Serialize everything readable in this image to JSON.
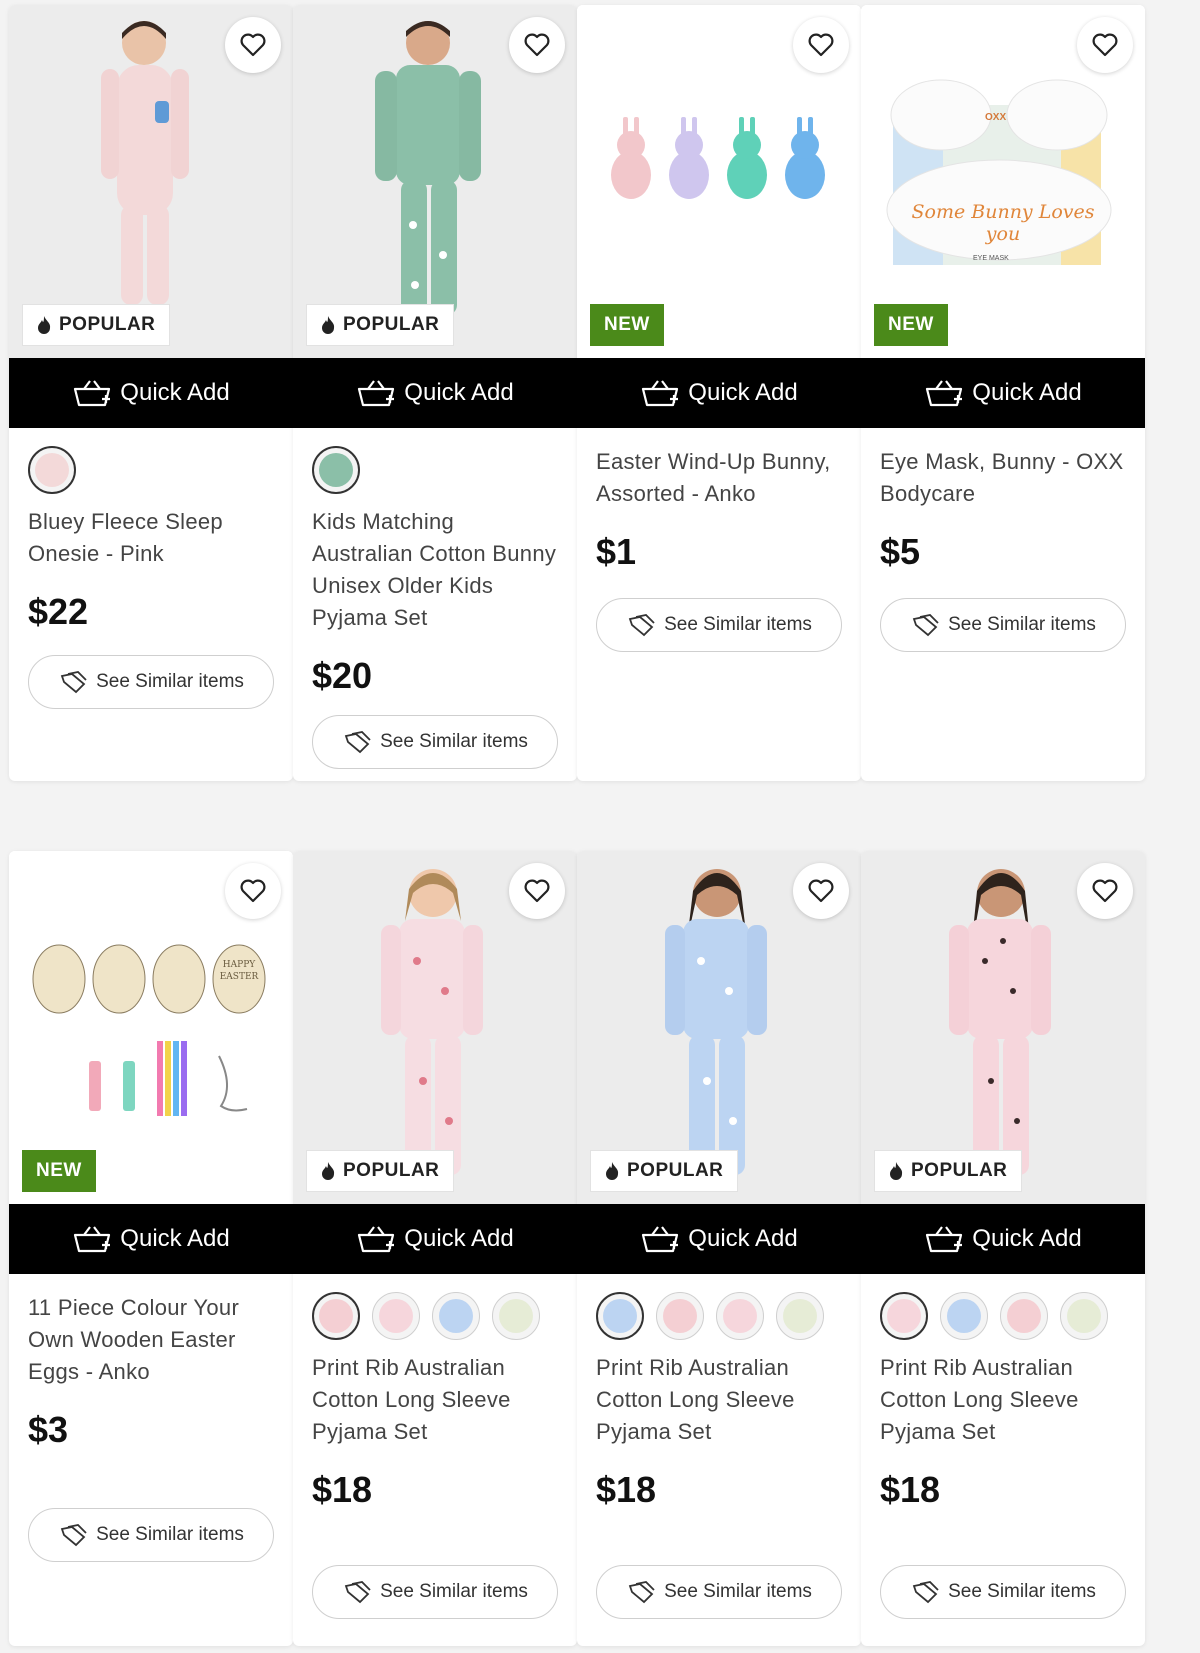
{
  "products": [
    {
      "badge": "POPULAR",
      "badge_type": "popular",
      "quick_add": "Quick Add",
      "title": "Bluey Fleece Sleep Onesie - Pink",
      "price": "$22",
      "similar": "See Similar items",
      "swatches": [
        "#f3d9d9"
      ],
      "selected_swatch": 0
    },
    {
      "badge": "POPULAR",
      "badge_type": "popular",
      "quick_add": "Quick Add",
      "title": "Kids Matching Australian Cotton Bunny Unisex Older Kids Pyjama Set",
      "price": "$20",
      "similar": "See Similar items",
      "swatches": [
        "#8bbfa8"
      ],
      "selected_swatch": 0
    },
    {
      "badge": "NEW",
      "badge_type": "new",
      "quick_add": "Quick Add",
      "title": "Easter Wind-Up Bunny, Assorted - Anko",
      "price": "$1",
      "similar": "See Similar items",
      "swatches": []
    },
    {
      "badge": "NEW",
      "badge_type": "new",
      "quick_add": "Quick Add",
      "title": "Eye Mask, Bunny - OXX Bodycare",
      "price": "$5",
      "similar": "See Similar items",
      "swatches": []
    },
    {
      "badge": "NEW",
      "badge_type": "new",
      "quick_add": "Quick Add",
      "title": "11 Piece Colour Your Own Wooden Easter Eggs - Anko",
      "price": "$3",
      "similar": "See Similar items",
      "swatches": []
    },
    {
      "badge": "POPULAR",
      "badge_type": "popular",
      "quick_add": "Quick Add",
      "title": "Print Rib Australian Cotton Long Sleeve Pyjama Set",
      "price": "$18",
      "similar": "See Similar items",
      "swatches": [
        "#f4cfd3",
        "#f6d6dc",
        "#bcd4f2",
        "#e6ecd6"
      ],
      "selected_swatch": 0
    },
    {
      "badge": "POPULAR",
      "badge_type": "popular",
      "quick_add": "Quick Add",
      "title": "Print Rib Australian Cotton Long Sleeve Pyjama Set",
      "price": "$18",
      "similar": "See Similar items",
      "swatches": [
        "#bcd4f2",
        "#f4cfd3",
        "#f6d6dc",
        "#e6ecd6"
      ],
      "selected_swatch": 0
    },
    {
      "badge": "POPULAR",
      "badge_type": "popular",
      "quick_add": "Quick Add",
      "title": "Print Rib Australian Cotton Long Sleeve Pyjama Set",
      "price": "$18",
      "similar": "See Similar items",
      "swatches": [
        "#f6d6dc",
        "#bcd4f2",
        "#f4cfd3",
        "#e6ecd6"
      ],
      "selected_swatch": 0
    }
  ],
  "eye_mask_print": {
    "brand": "OXX",
    "text": "Some Bunny Loves you",
    "label": "EYE MASK"
  },
  "eggs_print": {
    "text": "HAPPY EASTER"
  },
  "colors": {
    "new_badge": "#4b8a1a",
    "quick_add_bg": "#000000"
  },
  "icons": {
    "wishlist": "heart-icon",
    "quick_add": "basket-icon",
    "similar": "tags-icon",
    "popular": "flame-icon"
  }
}
